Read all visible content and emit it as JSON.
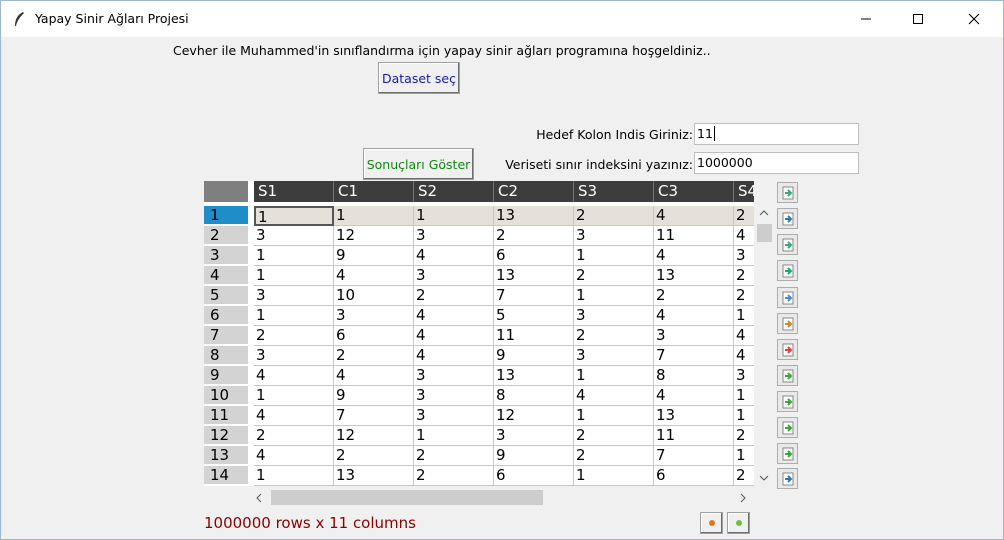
{
  "window": {
    "title": "Yapay Sinir Ağları Projesi"
  },
  "welcome_text": "Cevher ile Muhammed'in sınıflandırma için yapay sinir ağları programına hoşgeldiniz..",
  "buttons": {
    "dataset": "Dataset seç",
    "results": "Sonuçları Göster"
  },
  "colors": {
    "dataset_text": "#1a1aa6",
    "results_text": "#118811",
    "status_text": "#8b0000",
    "selected_row_index": "#1f8ec8"
  },
  "target_column": {
    "label": "Hedef Kolon Indis Giriniz:",
    "value": "11"
  },
  "limit_index": {
    "label": "Veriseti sınır indeksini yazınız:",
    "value": "1000000"
  },
  "table": {
    "columns": [
      "S1",
      "C1",
      "S2",
      "C2",
      "S3",
      "C3",
      "S4"
    ],
    "rows": [
      {
        "index": "1",
        "values": [
          "1",
          "1",
          "1",
          "13",
          "2",
          "4",
          "2"
        ]
      },
      {
        "index": "2",
        "values": [
          "3",
          "12",
          "3",
          "2",
          "3",
          "11",
          "4"
        ]
      },
      {
        "index": "3",
        "values": [
          "1",
          "9",
          "4",
          "6",
          "1",
          "4",
          "3"
        ]
      },
      {
        "index": "4",
        "values": [
          "1",
          "4",
          "3",
          "13",
          "2",
          "13",
          "2"
        ]
      },
      {
        "index": "5",
        "values": [
          "3",
          "10",
          "2",
          "7",
          "1",
          "2",
          "2"
        ]
      },
      {
        "index": "6",
        "values": [
          "1",
          "3",
          "4",
          "5",
          "3",
          "4",
          "1"
        ]
      },
      {
        "index": "7",
        "values": [
          "2",
          "6",
          "4",
          "11",
          "2",
          "3",
          "4"
        ]
      },
      {
        "index": "8",
        "values": [
          "3",
          "2",
          "4",
          "9",
          "3",
          "7",
          "4"
        ]
      },
      {
        "index": "9",
        "values": [
          "4",
          "4",
          "3",
          "13",
          "1",
          "8",
          "3"
        ]
      },
      {
        "index": "10",
        "values": [
          "1",
          "9",
          "3",
          "8",
          "4",
          "4",
          "1"
        ]
      },
      {
        "index": "11",
        "values": [
          "4",
          "7",
          "3",
          "12",
          "1",
          "13",
          "1"
        ]
      },
      {
        "index": "12",
        "values": [
          "2",
          "12",
          "1",
          "3",
          "2",
          "11",
          "2"
        ]
      },
      {
        "index": "13",
        "values": [
          "4",
          "2",
          "2",
          "9",
          "2",
          "7",
          "1"
        ]
      },
      {
        "index": "14",
        "values": [
          "1",
          "13",
          "2",
          "6",
          "1",
          "6",
          "2"
        ]
      }
    ]
  },
  "toolbar_icons": [
    "load-icon",
    "save-icon",
    "import-icon",
    "export-excel-icon",
    "copy-icon",
    "paste-icon",
    "plot-icon",
    "undo-icon",
    "redo-icon",
    "transform-icon",
    "merge-icon",
    "chart-icon"
  ],
  "status": "1000000 rows x 11 columns",
  "scrollbar": {
    "left_arrow": "<",
    "right_arrow": ">",
    "up_arrow": "^",
    "down_arrow": "v"
  }
}
